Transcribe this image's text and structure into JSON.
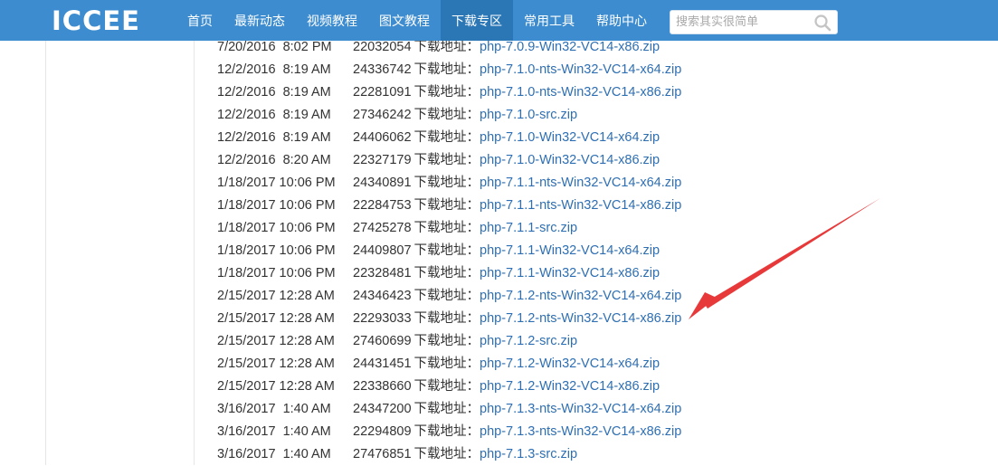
{
  "header": {
    "logo_text": "ICCEE",
    "nav": [
      "首页",
      "最新动态",
      "视频教程",
      "图文教程",
      "下载专区",
      "常用工具",
      "帮助中心"
    ],
    "active_nav_index": 4,
    "search_placeholder": "搜索其实很简单",
    "search_icon": "search-icon",
    "colors": {
      "bar": "#3d8ccf",
      "active": "#2b76b5",
      "link": "#2e6fb3",
      "arrow": "#e8393a"
    }
  },
  "download_label": "下载地址：",
  "files": [
    {
      "date": "7/20/2016  8:02 PM",
      "size": "22032054",
      "name": "php-7.0.9-Win32-VC14-x86.zip"
    },
    {
      "date": "12/2/2016  8:19 AM",
      "size": "24336742",
      "name": "php-7.1.0-nts-Win32-VC14-x64.zip"
    },
    {
      "date": "12/2/2016  8:19 AM",
      "size": "22281091",
      "name": "php-7.1.0-nts-Win32-VC14-x86.zip"
    },
    {
      "date": "12/2/2016  8:19 AM",
      "size": "27346242",
      "name": "php-7.1.0-src.zip"
    },
    {
      "date": "12/2/2016  8:19 AM",
      "size": "24406062",
      "name": "php-7.1.0-Win32-VC14-x64.zip"
    },
    {
      "date": "12/2/2016  8:20 AM",
      "size": "22327179",
      "name": "php-7.1.0-Win32-VC14-x86.zip"
    },
    {
      "date": "1/18/2017 10:06 PM",
      "size": "24340891",
      "name": "php-7.1.1-nts-Win32-VC14-x64.zip"
    },
    {
      "date": "1/18/2017 10:06 PM",
      "size": "22284753",
      "name": "php-7.1.1-nts-Win32-VC14-x86.zip"
    },
    {
      "date": "1/18/2017 10:06 PM",
      "size": "27425278",
      "name": "php-7.1.1-src.zip"
    },
    {
      "date": "1/18/2017 10:06 PM",
      "size": "24409807",
      "name": "php-7.1.1-Win32-VC14-x64.zip"
    },
    {
      "date": "1/18/2017 10:06 PM",
      "size": "22328481",
      "name": "php-7.1.1-Win32-VC14-x86.zip"
    },
    {
      "date": "2/15/2017 12:28 AM",
      "size": "24346423",
      "name": "php-7.1.2-nts-Win32-VC14-x64.zip"
    },
    {
      "date": "2/15/2017 12:28 AM",
      "size": "22293033",
      "name": "php-7.1.2-nts-Win32-VC14-x86.zip"
    },
    {
      "date": "2/15/2017 12:28 AM",
      "size": "27460699",
      "name": "php-7.1.2-src.zip"
    },
    {
      "date": "2/15/2017 12:28 AM",
      "size": "24431451",
      "name": "php-7.1.2-Win32-VC14-x64.zip"
    },
    {
      "date": "2/15/2017 12:28 AM",
      "size": "22338660",
      "name": "php-7.1.2-Win32-VC14-x86.zip"
    },
    {
      "date": "3/16/2017  1:40 AM",
      "size": "24347200",
      "name": "php-7.1.3-nts-Win32-VC14-x64.zip"
    },
    {
      "date": "3/16/2017  1:40 AM",
      "size": "22294809",
      "name": "php-7.1.3-nts-Win32-VC14-x86.zip"
    },
    {
      "date": "3/16/2017  1:40 AM",
      "size": "27476851",
      "name": "php-7.1.3-src.zip"
    }
  ]
}
